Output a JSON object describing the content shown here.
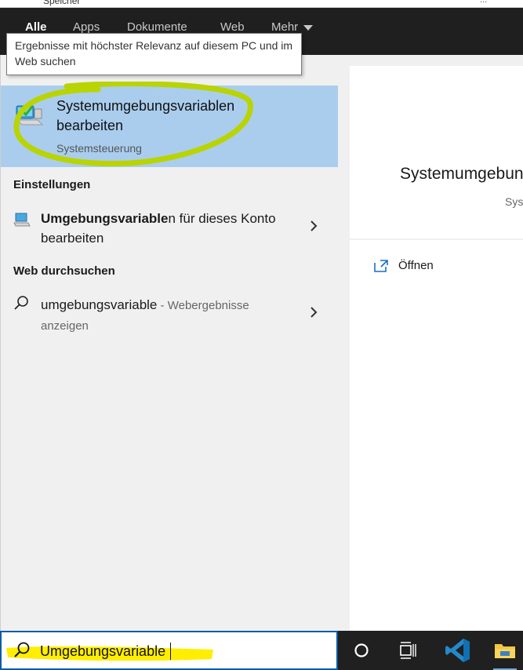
{
  "background_window": {
    "left_text": "Speicher",
    "right_text": "..."
  },
  "tabs": [
    {
      "label": "Alle",
      "active": true
    },
    {
      "label": "Apps",
      "active": false
    },
    {
      "label": "Dokumente",
      "active": false
    },
    {
      "label": "Web",
      "active": false
    },
    {
      "label": "Mehr",
      "active": false
    }
  ],
  "tooltip": {
    "text": "Ergebnisse mit höchster Relevanz auf diesem PC und im Web suchen"
  },
  "best_match": {
    "title": "Systemumgebungsvariablen bearbeiten",
    "subtitle": "Systemsteuerung",
    "icon": "control-panel-icon"
  },
  "sections": {
    "settings_label": "Einstellungen",
    "web_label": "Web durchsuchen"
  },
  "settings_result": {
    "bold_part": "Umgebungsvariable",
    "rest": "n für dieses Konto bearbeiten",
    "icon": "settings-monitor-icon"
  },
  "web_result": {
    "query": "umgebungsvariable",
    "suffix": " - Webergebnisse anzeigen",
    "icon": "search-icon"
  },
  "preview": {
    "title": "Systemumgebun",
    "subtitle": "Sys",
    "open_label": "Öffnen",
    "open_icon": "open-external-icon"
  },
  "search": {
    "value": "Umgebungsvariable",
    "placeholder": ""
  },
  "taskbar": {
    "items": [
      "cortana-icon",
      "task-view-icon",
      "vscode-icon",
      "file-explorer-icon"
    ]
  },
  "colors": {
    "accent": "#0a5aa8",
    "best_match_bg": "#aacdee",
    "highlighter_green": "#b9d400",
    "highlighter_yellow": "#ffee00",
    "taskbar_bg": "#202020",
    "tabbar_bg": "#1f1f1f"
  }
}
